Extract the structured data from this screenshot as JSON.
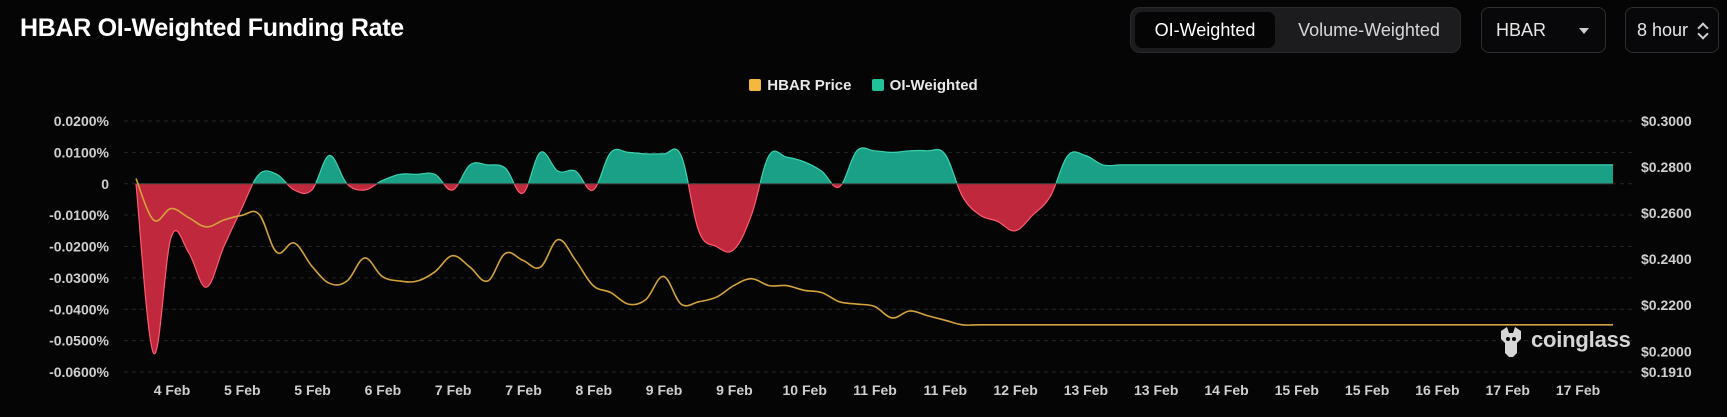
{
  "header": {
    "title": "HBAR OI-Weighted Funding Rate",
    "tabs": [
      {
        "label": "OI-Weighted",
        "active": true
      },
      {
        "label": "Volume-Weighted",
        "active": false
      }
    ],
    "symbol_select": {
      "value": "HBAR"
    },
    "interval_select": {
      "value": "8 hour"
    }
  },
  "brand": {
    "name": "coinglass"
  },
  "colors": {
    "positive": "#1aa086",
    "negative": "#c0283d",
    "price": "#d4a23c",
    "legend_price": "#f3b93e",
    "legend_oi": "#1fc29a"
  },
  "chart_data": {
    "type": "area",
    "legend": [
      "HBAR Price",
      "OI-Weighted"
    ],
    "legend_position": "top-center",
    "grid": true,
    "x_labels": [
      "4 Feb",
      "5 Feb",
      "5 Feb",
      "6 Feb",
      "7 Feb",
      "7 Feb",
      "8 Feb",
      "9 Feb",
      "9 Feb",
      "10 Feb",
      "11 Feb",
      "11 Feb",
      "12 Feb",
      "13 Feb",
      "13 Feb",
      "14 Feb",
      "15 Feb",
      "15 Feb",
      "16 Feb",
      "17 Feb",
      "17 Feb"
    ],
    "y_left": {
      "ticks": [
        "0.0200%",
        "0.0100%",
        "0",
        "-0.0100%",
        "-0.0200%",
        "-0.0300%",
        "-0.0400%",
        "-0.0500%",
        "-0.0600%"
      ],
      "range": [
        -0.06,
        0.02
      ],
      "unit": "%"
    },
    "y_right": {
      "ticks": [
        "$0.3000",
        "$0.2800",
        "$0.2600",
        "$0.2400",
        "$0.2200",
        "$0.2000",
        "$0.1910"
      ],
      "range": [
        0.191,
        0.3
      ]
    },
    "series": [
      {
        "name": "OI-Weighted",
        "x": [
          0.0,
          0.5,
          1.0,
          1.5,
          2.0,
          2.5,
          3.0,
          3.5,
          4.0,
          4.5,
          5.0,
          5.5,
          6.0,
          6.5,
          7.0,
          7.5,
          8.0,
          8.5,
          9.0,
          9.5,
          10.0,
          10.5,
          11.0,
          11.5,
          12.0,
          12.5,
          13.0,
          13.5,
          14.0,
          14.5,
          15.0,
          15.5,
          16.0,
          16.5,
          17.0,
          17.5,
          18.0,
          18.5,
          19.0,
          19.5,
          20.0,
          20.5,
          21.0,
          21.5,
          22.0,
          22.5,
          23.0,
          23.5,
          24.0,
          24.5,
          25.0,
          25.5,
          26.0,
          26.5,
          27.0,
          27.5,
          28.0,
          28.5,
          29.0,
          29.5,
          30.0,
          30.5,
          31.0,
          31.5,
          32.0,
          32.5,
          33.0,
          33.5,
          34.0,
          34.5,
          35.0,
          35.5,
          36.0,
          36.5,
          37.0,
          37.5,
          38.0,
          38.5,
          39.0,
          39.5,
          40.0,
          40.5,
          41.0,
          41.5,
          42.0
        ],
        "values": [
          0.0,
          -0.054,
          -0.017,
          -0.022,
          -0.033,
          -0.02,
          -0.008,
          0.003,
          0.003,
          -0.002,
          -0.002,
          0.009,
          0.0,
          -0.002,
          0.001,
          0.003,
          0.003,
          0.003,
          -0.002,
          0.006,
          0.006,
          0.005,
          -0.003,
          0.01,
          0.004,
          0.004,
          -0.002,
          0.01,
          0.01,
          0.0095,
          0.0095,
          0.009,
          -0.015,
          -0.02,
          -0.021,
          -0.01,
          0.009,
          0.0085,
          0.007,
          0.004,
          -0.001,
          0.0105,
          0.0105,
          0.01,
          0.0105,
          0.0105,
          0.0095,
          -0.004,
          -0.01,
          -0.012,
          -0.015,
          -0.01,
          -0.004,
          0.009,
          0.009,
          0.006,
          0.006,
          0.006,
          0.006,
          0.006,
          0.006,
          0.006,
          0.006,
          0.006,
          0.006,
          0.006,
          0.006,
          0.006,
          0.006,
          0.006,
          0.006,
          0.006,
          0.006,
          0.006,
          0.006,
          0.006,
          0.006,
          0.006,
          0.006,
          0.006,
          0.006,
          0.006,
          0.006,
          0.006,
          0.006
        ]
      },
      {
        "name": "HBAR Price",
        "x": [
          0.0,
          0.5,
          1.0,
          1.5,
          2.0,
          2.5,
          3.0,
          3.5,
          4.0,
          4.5,
          5.0,
          5.5,
          6.0,
          6.5,
          7.0,
          7.5,
          8.0,
          8.5,
          9.0,
          9.5,
          10.0,
          10.5,
          11.0,
          11.5,
          12.0,
          12.5,
          13.0,
          13.5,
          14.0,
          14.5,
          15.0,
          15.5,
          16.0,
          16.5,
          17.0,
          17.5,
          18.0,
          18.5,
          19.0,
          19.5,
          20.0,
          20.5,
          21.0,
          21.5,
          22.0,
          22.5,
          23.0,
          23.5,
          24.0,
          24.5,
          25.0,
          25.5,
          26.0,
          26.5,
          27.0,
          27.5,
          28.0,
          28.5,
          29.0,
          29.5,
          30.0,
          30.5,
          31.0,
          31.5,
          32.0,
          32.5,
          33.0,
          33.5,
          34.0,
          34.5,
          35.0,
          35.5,
          36.0,
          36.5,
          37.0,
          37.5,
          38.0,
          38.5,
          39.0,
          39.5,
          40.0,
          40.5,
          41.0,
          41.5,
          42.0
        ],
        "values": [
          0.275,
          0.257,
          0.262,
          0.258,
          0.254,
          0.257,
          0.259,
          0.2595,
          0.243,
          0.247,
          0.237,
          0.2295,
          0.2305,
          0.2405,
          0.2325,
          0.2305,
          0.2305,
          0.2345,
          0.2415,
          0.2365,
          0.2305,
          0.2425,
          0.2395,
          0.2365,
          0.2485,
          0.2395,
          0.2285,
          0.2255,
          0.2205,
          0.2225,
          0.2325,
          0.2205,
          0.2215,
          0.2235,
          0.2285,
          0.2315,
          0.2285,
          0.2285,
          0.2265,
          0.2255,
          0.2215,
          0.2205,
          0.2195,
          0.2145,
          0.2175,
          0.2155,
          0.2135,
          0.2115,
          0.2115,
          0.2115,
          0.2115,
          0.2115,
          0.2115,
          0.2115,
          0.2115,
          0.2115,
          0.2115,
          0.2115,
          0.2115,
          0.2115,
          0.2115,
          0.2115,
          0.2115,
          0.2115,
          0.2115,
          0.2115,
          0.2115,
          0.2115,
          0.2115,
          0.2115,
          0.2115,
          0.2115,
          0.2115,
          0.2115,
          0.2115,
          0.2115,
          0.2115,
          0.2115,
          0.2115,
          0.2115,
          0.2115,
          0.2115,
          0.2115,
          0.2115,
          0.2115
        ]
      }
    ]
  }
}
